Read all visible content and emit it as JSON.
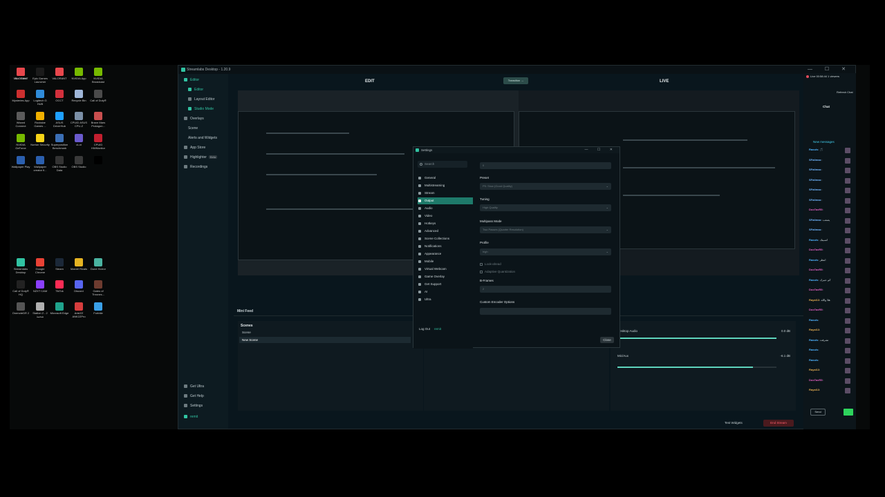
{
  "window": {
    "title": "Streamlabs Desktop - 1.20.9",
    "controls": "— ☐ ✕"
  },
  "desktop_icons": [
    {
      "label": "Riot Client",
      "color": "#d13639"
    },
    {
      "label": "Epic Games Launcher",
      "color": "#1b1b1b"
    },
    {
      "label": "VALORANT",
      "color": "#e8474c"
    },
    {
      "label": "NVIDIA App",
      "color": "#76b900"
    },
    {
      "label": "NVIDIA Broadcast",
      "color": "#76b900"
    },
    {
      "label": "Mysteries App",
      "color": "#cc2f2f"
    },
    {
      "label": "Logitech G HUB",
      "color": "#2f8bd8"
    },
    {
      "label": "OCCT",
      "color": "#d2303c"
    },
    {
      "label": "Recycle Bin",
      "color": "#9fb6d8"
    },
    {
      "label": "Call of Duty®",
      "color": "#4a4a4a"
    },
    {
      "label": "Wizard Connect",
      "color": "#5b5b5b"
    },
    {
      "label": "Rockstar Games ...",
      "color": "#f0b000"
    },
    {
      "label": "ASUS DriverHub",
      "color": "#1ea0ff"
    },
    {
      "label": "CPUID ASUS CPU-Z",
      "color": "#7b8fa6"
    },
    {
      "label": "Brave Mars Protagon...",
      "color": "#c94f4f"
    },
    {
      "label": "NVIDIA GeForce",
      "color": "#76b900"
    },
    {
      "label": "Norton Security",
      "color": "#f7d417"
    },
    {
      "label": "Superposition Benchmark",
      "color": "#3b6fb5"
    },
    {
      "label": "cLot",
      "color": "#6a5acd"
    },
    {
      "label": "CPUID HWMonitor",
      "color": "#c21f2f"
    },
    {
      "label": "Wallpaper Play",
      "color": "#2b5fae"
    },
    {
      "label": "Wallpaper creator fi...",
      "color": "#2b5fae"
    },
    {
      "label": "OBS Studio Data",
      "color": "#333333"
    },
    {
      "label": "OBS Studio",
      "color": "#3a3a3a"
    },
    {
      "label": "",
      "color": "#000000"
    },
    {
      "label": "Streamlabs Desktop",
      "color": "#31c3a2"
    },
    {
      "label": "Google Chrome",
      "color": "#e94235"
    },
    {
      "label": "Steam",
      "color": "#1b2838"
    },
    {
      "label": "Marvel Rivals",
      "color": "#e6b422"
    },
    {
      "label": "Dune Horror",
      "color": "#4ab3a0"
    },
    {
      "label": "Call of Duty® HQ",
      "color": "#222222"
    },
    {
      "label": "NZXT CAM",
      "color": "#8a3ffc"
    },
    {
      "label": "TikTok",
      "color": "#fe2c55"
    },
    {
      "label": "Discord",
      "color": "#5865f2"
    },
    {
      "label": "Gates of Thrones...",
      "color": "#6d3b2f"
    },
    {
      "label": "OnenoteDR 2",
      "color": "#555555"
    },
    {
      "label": "Station 2 - 2 شحمة",
      "color": "#b0b0b0"
    },
    {
      "label": "Microsoft Edge",
      "color": "#1fa38c"
    },
    {
      "label": "AnkiZZ ANK2ZPro",
      "color": "#d63d3d"
    },
    {
      "label": "Fortnite",
      "color": "#3aa0e8"
    },
    {
      "label": "VALORANT",
      "color": "#e8474c"
    }
  ],
  "sidebar": {
    "items": [
      {
        "label": "Editor",
        "active": true
      },
      {
        "label": "Editor",
        "active": true
      },
      {
        "label": "Layout Editor",
        "active": false
      },
      {
        "label": "Studio Mode",
        "active": true
      },
      {
        "label": "Overlays",
        "active": false
      },
      {
        "label": "Scene",
        "active": false
      },
      {
        "label": "Alerts and Widgets",
        "active": false
      },
      {
        "label": "App Store",
        "active": false
      },
      {
        "label": "Highlighter",
        "active": false,
        "beta": "Beta"
      },
      {
        "label": "Recordings",
        "active": false
      }
    ],
    "bottom": [
      "Get Ultra",
      "Get Help",
      "Settings",
      "remit"
    ]
  },
  "main": {
    "edit_label": "EDIT",
    "live_label": "LIVE",
    "transition_label": "Transition →",
    "mini_feed": "Mini Feed",
    "scenes_title": "Scenes",
    "scenes": [
      {
        "label": "Scene",
        "selected": false
      },
      {
        "label": "New Scene",
        "selected": true
      }
    ],
    "mixer": [
      {
        "label": "Desktop Audio",
        "value": "0.0 dB",
        "level": 1.0
      },
      {
        "label": "Mic/Aux",
        "value": "-6.1 dB",
        "level": 0.85
      }
    ],
    "test_widgets": "Test Widgets",
    "end_stream": "End Stream"
  },
  "settings_dialog": {
    "title": "Settings",
    "search_placeholder": "Search",
    "nav": [
      {
        "label": "General",
        "active": false
      },
      {
        "label": "Multistreaming",
        "active": false
      },
      {
        "label": "Stream",
        "active": false
      },
      {
        "label": "Output",
        "active": true
      },
      {
        "label": "Audio",
        "active": false
      },
      {
        "label": "Video",
        "active": false
      },
      {
        "label": "Hotkeys",
        "active": false
      },
      {
        "label": "Advanced",
        "active": false
      },
      {
        "label": "Scene Collections",
        "active": false
      },
      {
        "label": "Notifications",
        "active": false
      },
      {
        "label": "Appearance",
        "active": false
      },
      {
        "label": "Mobile",
        "active": false
      },
      {
        "label": "Virtual Webcam",
        "active": false
      },
      {
        "label": "Game Overlay",
        "active": false
      },
      {
        "label": "Get Support",
        "active": false
      },
      {
        "label": "AI",
        "active": false
      },
      {
        "label": "Ultra",
        "active": false
      }
    ],
    "log_out": "Log Out",
    "account": "remit",
    "fields": {
      "top_value": "0",
      "preset_label": "Preset",
      "preset_value": "P5: Slow (Good Quality)",
      "tuning_label": "Tuning",
      "tuning_value": "High Quality",
      "multipass_label": "Multipass Mode",
      "multipass_value": "Two Passes (Quarter Resolution)",
      "profile_label": "Profile",
      "profile_value": "high",
      "look_ahead": "Look-ahead",
      "adaptive_quant": "Adaptive Quantization",
      "bframes_label": "B-Frames",
      "bframes_value": "2",
      "custom_label": "Custom Encoder Options",
      "custom_value": ""
    },
    "close_label": "Close"
  },
  "chat": {
    "status": "Live 00:58:44",
    "viewers": "1 viewers",
    "refresh": "Refresh Chat",
    "title": "Chat",
    "new_messages": "New messages",
    "messages": [
      {
        "user": "Raouls",
        "text": "🎵",
        "color": "#4fb3ff"
      },
      {
        "user": "SFatimaz",
        "text": "",
        "color": "#6fb6ff"
      },
      {
        "user": "SFatimaz",
        "text": "",
        "color": "#6fb6ff"
      },
      {
        "user": "SFatimaz",
        "text": "",
        "color": "#6fb6ff"
      },
      {
        "user": "SFatimaz",
        "text": "",
        "color": "#6fb6ff"
      },
      {
        "user": "SFatimaz",
        "text": "",
        "color": "#6fb6ff"
      },
      {
        "user": "DooTaxR5",
        "text": "",
        "color": "#e05ec0"
      },
      {
        "user": "SFatimaz",
        "text": "يصعب",
        "color": "#6fb6ff"
      },
      {
        "user": "SFatimaz",
        "text": "",
        "color": "#6fb6ff"
      },
      {
        "user": "Raouls",
        "text": "انسيتك",
        "color": "#4fb3ff"
      },
      {
        "user": "DooTaxR5",
        "text": "",
        "color": "#e05ec0"
      },
      {
        "user": "Raouls",
        "text": "انتظر",
        "color": "#4fb3ff"
      },
      {
        "user": "DooTaxR5",
        "text": "",
        "color": "#e05ec0"
      },
      {
        "user": "Raouls",
        "text": "كم عمرك",
        "color": "#4fb3ff"
      },
      {
        "user": "DooTaxR5",
        "text": "",
        "color": "#e05ec0"
      },
      {
        "user": "Rayal13",
        "text": "هلا والله",
        "color": "#e0a94f"
      },
      {
        "user": "DooTaxR5",
        "text": "",
        "color": "#e05ec0"
      },
      {
        "user": "Raouls",
        "text": "",
        "color": "#4fb3ff"
      },
      {
        "user": "Rayal13",
        "text": "",
        "color": "#e0a94f"
      },
      {
        "user": "Raouls",
        "text": "تشرفت",
        "color": "#4fb3ff"
      },
      {
        "user": "Raouls",
        "text": "",
        "color": "#4fb3ff"
      },
      {
        "user": "Raouls",
        "text": "",
        "color": "#4fb3ff"
      },
      {
        "user": "Rayal13",
        "text": "",
        "color": "#e0a94f"
      },
      {
        "user": "DooTaxR5",
        "text": "",
        "color": "#e05ec0"
      },
      {
        "user": "Rayal13",
        "text": "",
        "color": "#e0a94f"
      }
    ],
    "input_label": "Send"
  }
}
